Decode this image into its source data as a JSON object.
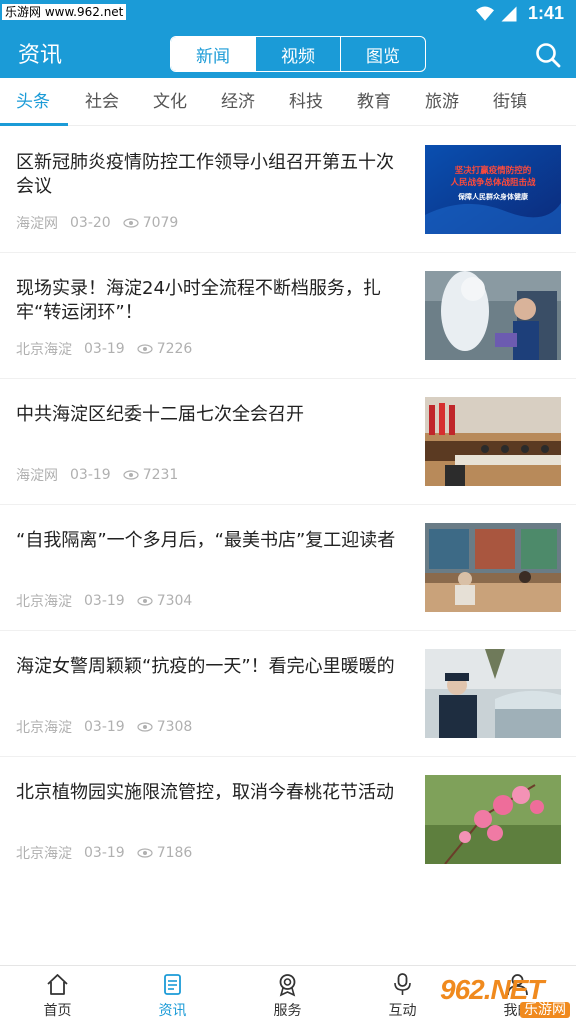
{
  "status": {
    "watermark": "乐游网 www.962.net",
    "time": "1:41"
  },
  "header": {
    "title": "资讯",
    "segments": [
      {
        "label": "新闻",
        "active": true
      },
      {
        "label": "视频",
        "active": false
      },
      {
        "label": "图览",
        "active": false
      }
    ]
  },
  "categories": [
    {
      "label": "头条",
      "active": true
    },
    {
      "label": "社会",
      "active": false
    },
    {
      "label": "文化",
      "active": false
    },
    {
      "label": "经济",
      "active": false
    },
    {
      "label": "科技",
      "active": false
    },
    {
      "label": "教育",
      "active": false
    },
    {
      "label": "旅游",
      "active": false
    },
    {
      "label": "街镇",
      "active": false
    }
  ],
  "articles": [
    {
      "title": "区新冠肺炎疫情防控工作领导小组召开第五十次会议",
      "source": "海淀网",
      "date": "03-20",
      "views": "7079",
      "thumb_text": [
        "坚决打赢疫情防控的",
        "人民战争总体战阻击战",
        "保障人民群众身体健康"
      ]
    },
    {
      "title": "现场实录！海淀24小时全流程不断档服务，扎牢“转运闭环”！",
      "source": "北京海淀",
      "date": "03-19",
      "views": "7226"
    },
    {
      "title": "中共海淀区纪委十二届七次全会召开",
      "source": "海淀网",
      "date": "03-19",
      "views": "7231"
    },
    {
      "title": "“自我隔离”一个多月后，“最美书店”复工迎读者",
      "source": "北京海淀",
      "date": "03-19",
      "views": "7304"
    },
    {
      "title": "海淀女警周颖颖“抗疫的一天”！看完心里暖暖的",
      "source": "北京海淀",
      "date": "03-19",
      "views": "7308"
    },
    {
      "title": "北京植物园实施限流管控，取消今春桃花节活动",
      "source": "北京海淀",
      "date": "03-19",
      "views": "7186"
    }
  ],
  "tabbar": [
    {
      "label": "首页",
      "icon": "home-icon",
      "active": false
    },
    {
      "label": "资讯",
      "icon": "news-icon",
      "active": true
    },
    {
      "label": "服务",
      "icon": "service-icon",
      "active": false
    },
    {
      "label": "互动",
      "icon": "microphone-icon",
      "active": false
    },
    {
      "label": "我的",
      "icon": "user-icon",
      "active": false
    }
  ],
  "watermark_br": {
    "big": "962.NET",
    "small": "乐游网"
  },
  "colors": {
    "accent": "#1b9bd7",
    "text": "#222222",
    "meta": "#b0b0b0"
  }
}
